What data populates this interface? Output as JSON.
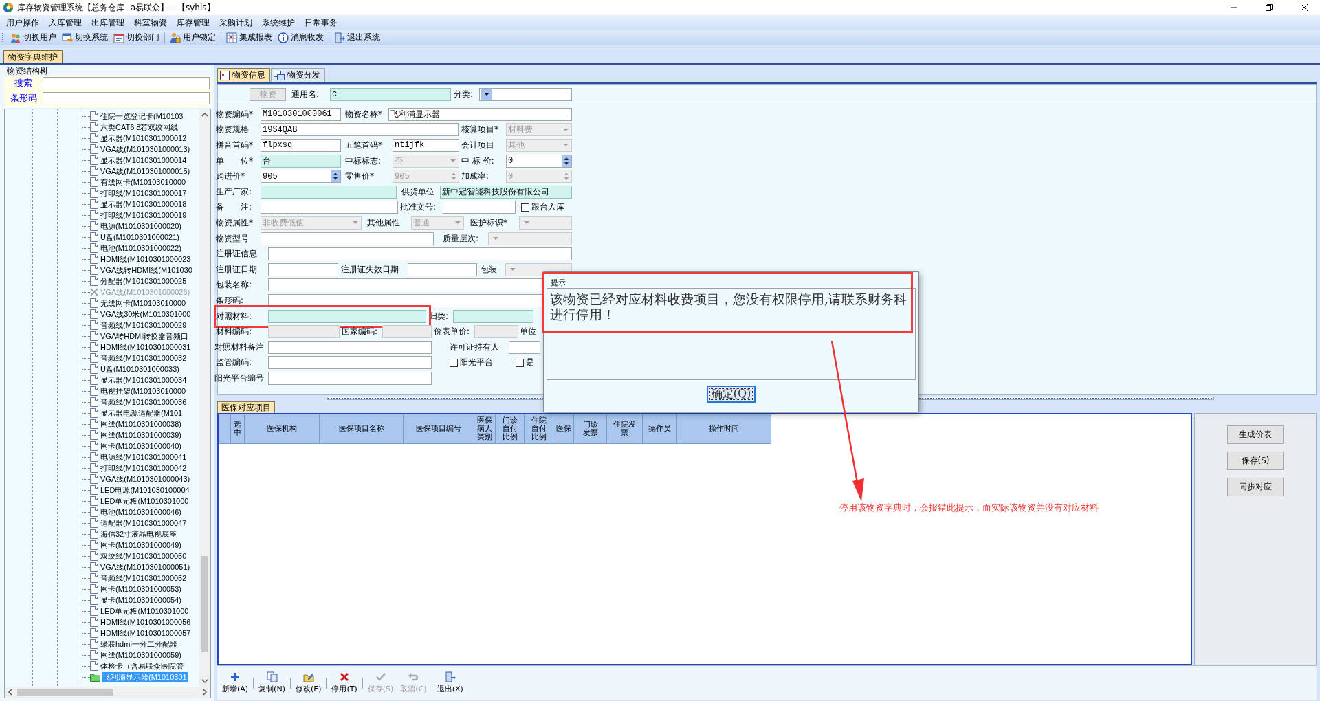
{
  "window": {
    "title": "库存物资管理系统【总务仓库--a易联众】---【syhis】"
  },
  "menu": [
    "用户操作",
    "入库管理",
    "出库管理",
    "科室物资",
    "库存管理",
    "采购计划",
    "系统维护",
    "日常事务"
  ],
  "toolbar_groups": [
    [
      {
        "label": "切换用户"
      },
      {
        "label": "切换系统"
      },
      {
        "label": "切换部门"
      }
    ],
    [
      {
        "label": "用户锁定"
      }
    ],
    [
      {
        "label": "集成报表"
      },
      {
        "label": "消息收发"
      }
    ],
    [
      {
        "label": "退出系统"
      }
    ]
  ],
  "document_tabs": [
    {
      "label": "物资字典维护",
      "selected": true
    }
  ],
  "tree_panel": {
    "title": "物资结构树",
    "search_label": "搜索",
    "barcode_label": "条形码",
    "items": [
      {
        "label": "住院一览登记卡(M10103",
        "disabled": false,
        "selected": false
      },
      {
        "label": "六类CAT6 8芯双绞网线",
        "disabled": false,
        "selected": false
      },
      {
        "label": "显示器(M1010301000012",
        "disabled": false,
        "selected": false
      },
      {
        "label": "VGA线(M1010301000013)",
        "disabled": false,
        "selected": false
      },
      {
        "label": "显示器(M1010301000014",
        "disabled": false,
        "selected": false
      },
      {
        "label": "VGA线(M1010301000015)",
        "disabled": false,
        "selected": false
      },
      {
        "label": "有线网卡(M10103010000",
        "disabled": false,
        "selected": false
      },
      {
        "label": "打印线(M1010301000017",
        "disabled": false,
        "selected": false
      },
      {
        "label": "显示器(M1010301000018",
        "disabled": false,
        "selected": false
      },
      {
        "label": "打印线(M1010301000019",
        "disabled": false,
        "selected": false
      },
      {
        "label": "电源(M1010301000020)",
        "disabled": false,
        "selected": false
      },
      {
        "label": "U盘(M1010301000021)",
        "disabled": false,
        "selected": false
      },
      {
        "label": "电池(M1010301000022)",
        "disabled": false,
        "selected": false
      },
      {
        "label": "HDMI线(M1010301000023",
        "disabled": false,
        "selected": false
      },
      {
        "label": "VGA线转HDMI线(M101030",
        "disabled": false,
        "selected": false
      },
      {
        "label": "分配器(M1010301000025",
        "disabled": false,
        "selected": false
      },
      {
        "label": "VGA线(M1010301000026)",
        "disabled": true,
        "selected": false
      },
      {
        "label": "无线网卡(M10103010000",
        "disabled": false,
        "selected": false
      },
      {
        "label": "VGA线30米(M1010301000",
        "disabled": false,
        "selected": false
      },
      {
        "label": "音频线(M1010301000029",
        "disabled": false,
        "selected": false
      },
      {
        "label": "VGA转HDMI转换器音频口",
        "disabled": false,
        "selected": false
      },
      {
        "label": "HDMI线(M1010301000031",
        "disabled": false,
        "selected": false
      },
      {
        "label": "音频线(M1010301000032",
        "disabled": false,
        "selected": false
      },
      {
        "label": "U盘(M1010301000033)",
        "disabled": false,
        "selected": false
      },
      {
        "label": "显示器(M1010301000034",
        "disabled": false,
        "selected": false
      },
      {
        "label": "电视挂架(M10103010000",
        "disabled": false,
        "selected": false
      },
      {
        "label": "音频线(M1010301000036",
        "disabled": false,
        "selected": false
      },
      {
        "label": "显示器电源适配器(M101",
        "disabled": false,
        "selected": false
      },
      {
        "label": "网线(M1010301000038)",
        "disabled": false,
        "selected": false
      },
      {
        "label": "网线(M1010301000039)",
        "disabled": false,
        "selected": false
      },
      {
        "label": "网卡(M1010301000040)",
        "disabled": false,
        "selected": false
      },
      {
        "label": "电源线(M1010301000041",
        "disabled": false,
        "selected": false
      },
      {
        "label": "打印线(M1010301000042",
        "disabled": false,
        "selected": false
      },
      {
        "label": "VGA线(M1010301000043)",
        "disabled": false,
        "selected": false
      },
      {
        "label": "LED电源(M101030100004",
        "disabled": false,
        "selected": false
      },
      {
        "label": "LED单元板(M1010301000",
        "disabled": false,
        "selected": false
      },
      {
        "label": "电池(M1010301000046)",
        "disabled": false,
        "selected": false
      },
      {
        "label": "适配器(M1010301000047",
        "disabled": false,
        "selected": false
      },
      {
        "label": "海信32寸液晶电视底座",
        "disabled": false,
        "selected": false
      },
      {
        "label": "网卡(M1010301000049)",
        "disabled": false,
        "selected": false
      },
      {
        "label": "双绞线(M1010301000050",
        "disabled": false,
        "selected": false
      },
      {
        "label": "VGA线(M1010301000051)",
        "disabled": false,
        "selected": false
      },
      {
        "label": "音频线(M1010301000052",
        "disabled": false,
        "selected": false
      },
      {
        "label": "网卡(M1010301000053)",
        "disabled": false,
        "selected": false
      },
      {
        "label": "显卡(M1010301000054)",
        "disabled": false,
        "selected": false
      },
      {
        "label": "LED单元板(M1010301000",
        "disabled": false,
        "selected": false
      },
      {
        "label": "HDMI线(M1010301000056",
        "disabled": false,
        "selected": false
      },
      {
        "label": "HDMI线(M1010301000057",
        "disabled": false,
        "selected": false
      },
      {
        "label": "绿联hdmi一分二分配器",
        "disabled": false,
        "selected": false
      },
      {
        "label": "网线(M1010301000059)",
        "disabled": false,
        "selected": false
      },
      {
        "label": "体检卡（含易联众医院管",
        "disabled": false,
        "selected": false
      },
      {
        "label": "飞利浦显示器(M1010301",
        "disabled": false,
        "selected": true
      }
    ]
  },
  "detail_tabs": [
    {
      "label": "物资信息",
      "selected": true
    },
    {
      "label": "物资分发",
      "selected": false
    }
  ],
  "form": {
    "header": [
      {
        "kind": "button",
        "label": "物资",
        "disabled": true
      },
      {
        "kind": "label",
        "text": "通用名:"
      },
      {
        "kind": "input",
        "value": "c",
        "tinted": true,
        "disabled": false
      },
      {
        "kind": "label",
        "text": "分类:"
      },
      {
        "kind": "select",
        "tinted": false,
        "disabled": false
      }
    ],
    "rows": [
      {
        "highlighted": false,
        "items": [
          {
            "kind": "label",
            "text": "物资编码*"
          },
          {
            "kind": "input",
            "value": "M1010301000061",
            "tinted": false,
            "disabled": false
          },
          {
            "kind": "label",
            "text": "物资名称*"
          },
          {
            "kind": "input",
            "value": "飞利浦显示器",
            "tinted": false,
            "disabled": false
          }
        ]
      },
      {
        "highlighted": false,
        "items": [
          {
            "kind": "label",
            "text": "物资规格"
          },
          {
            "kind": "input",
            "value": "19S4QAB",
            "tinted": false,
            "disabled": false
          },
          {
            "kind": "label",
            "text": "核算项目*"
          },
          {
            "kind": "select",
            "value": "材料费",
            "tinted": false,
            "disabled": true
          }
        ]
      },
      {
        "highlighted": false,
        "items": [
          {
            "kind": "label",
            "text": "拼音首码*"
          },
          {
            "kind": "input",
            "value": "flpxsq",
            "tinted": false,
            "disabled": false
          },
          {
            "kind": "label",
            "text": "五笔首码*"
          },
          {
            "kind": "input",
            "value": "ntijfk",
            "tinted": false,
            "disabled": false
          },
          {
            "kind": "label",
            "text": "会计项目"
          },
          {
            "kind": "select",
            "value": "其他",
            "tinted": false,
            "disabled": true
          }
        ]
      },
      {
        "highlighted": false,
        "items": [
          {
            "kind": "label",
            "text": "单　　位*"
          },
          {
            "kind": "input",
            "value": "台",
            "tinted": true,
            "disabled": false
          },
          {
            "kind": "label",
            "text": "中标标志:"
          },
          {
            "kind": "select",
            "value": "否",
            "tinted": false,
            "disabled": true
          },
          {
            "kind": "label",
            "text": "中 标 价:"
          },
          {
            "kind": "spin",
            "value": "0",
            "tinted": false,
            "disabled": false
          }
        ]
      },
      {
        "highlighted": false,
        "items": [
          {
            "kind": "label",
            "text": "购进价*"
          },
          {
            "kind": "spin",
            "value": "905",
            "tinted": false,
            "disabled": false
          },
          {
            "kind": "label",
            "text": "零售价*"
          },
          {
            "kind": "spin",
            "value": "905",
            "tinted": false,
            "disabled": true
          },
          {
            "kind": "label",
            "text": "加成率:"
          },
          {
            "kind": "spin",
            "value": "0",
            "tinted": false,
            "disabled": true
          }
        ]
      },
      {
        "highlighted": false,
        "items": [
          {
            "kind": "label",
            "text": "生产厂家:"
          },
          {
            "kind": "input",
            "tinted": true,
            "disabled": false
          },
          {
            "kind": "label",
            "text": "供货单位"
          },
          {
            "kind": "input",
            "value": "新中冠智能科技股份有限公司",
            "tinted": true,
            "disabled": false
          }
        ]
      },
      {
        "highlighted": false,
        "items": [
          {
            "kind": "label",
            "text": "备　　注:"
          },
          {
            "kind": "input",
            "tinted": false,
            "disabled": false
          },
          {
            "kind": "label",
            "text": "批准文号:"
          },
          {
            "kind": "input",
            "tinted": false,
            "disabled": false
          },
          {
            "kind": "checkbox",
            "label": "跟台入库",
            "checked": false
          }
        ]
      },
      {
        "highlighted": false,
        "items": [
          {
            "kind": "label",
            "text": "物资属性*"
          },
          {
            "kind": "select",
            "value": "非收费低值",
            "tinted": false,
            "disabled": true
          },
          {
            "kind": "label",
            "text": "其他属性"
          },
          {
            "kind": "select",
            "value": "普通",
            "tinted": false,
            "disabled": true
          },
          {
            "kind": "label",
            "text": "医护标识*"
          },
          {
            "kind": "select",
            "tinted": false,
            "disabled": true
          }
        ]
      },
      {
        "highlighted": false,
        "items": [
          {
            "kind": "label",
            "text": "物资型号"
          },
          {
            "kind": "input",
            "tinted": false,
            "disabled": false
          },
          {
            "kind": "label",
            "text": "质量层次:"
          },
          {
            "kind": "select",
            "tinted": false,
            "disabled": true
          }
        ]
      },
      {
        "highlighted": false,
        "items": [
          {
            "kind": "label",
            "text": "注册证信息"
          },
          {
            "kind": "input",
            "tinted": false,
            "disabled": false
          }
        ]
      },
      {
        "highlighted": false,
        "items": [
          {
            "kind": "label",
            "text": "注册证日期"
          },
          {
            "kind": "input",
            "tinted": false,
            "disabled": false
          },
          {
            "kind": "label",
            "text": "注册证失效日期"
          },
          {
            "kind": "input",
            "tinted": false,
            "disabled": false
          },
          {
            "kind": "label",
            "text": "包装"
          },
          {
            "kind": "select",
            "tinted": false,
            "disabled": true
          }
        ]
      },
      {
        "highlighted": false,
        "items": [
          {
            "kind": "label",
            "text": "包装名称:"
          },
          {
            "kind": "input",
            "tinted": false,
            "disabled": false
          }
        ]
      },
      {
        "highlighted": false,
        "items": [
          {
            "kind": "label",
            "text": "条形码:"
          },
          {
            "kind": "input",
            "tinted": false,
            "disabled": false
          }
        ]
      },
      {
        "highlighted": true,
        "items": [
          {
            "kind": "label",
            "text": "对照材料:"
          },
          {
            "kind": "input",
            "tinted": true,
            "disabled": false
          },
          {
            "kind": "label",
            "text": "归类:"
          },
          {
            "kind": "input",
            "tinted": true,
            "disabled": false
          }
        ]
      },
      {
        "highlighted": false,
        "items": [
          {
            "kind": "label",
            "text": "材料编码:"
          },
          {
            "kind": "input",
            "tinted": false,
            "disabled": true
          },
          {
            "kind": "label",
            "text": "国家编码:"
          },
          {
            "kind": "input",
            "tinted": false,
            "disabled": true
          },
          {
            "kind": "label",
            "text": "价表单价:"
          },
          {
            "kind": "input",
            "tinted": false,
            "disabled": true
          },
          {
            "kind": "label",
            "text": "单位"
          }
        ]
      },
      {
        "highlighted": false,
        "items": [
          {
            "kind": "label",
            "text": "对照材料备注"
          },
          {
            "kind": "input",
            "tinted": false,
            "disabled": false
          },
          {
            "kind": "label",
            "text": "许可证持有人"
          },
          {
            "kind": "input",
            "tinted": false,
            "disabled": false
          }
        ]
      },
      {
        "highlighted": false,
        "items": [
          {
            "kind": "label",
            "text": "监管编码:"
          },
          {
            "kind": "input",
            "tinted": false,
            "disabled": false
          },
          {
            "kind": "checkbox",
            "label": "阳光平台",
            "checked": false
          },
          {
            "kind": "checkbox",
            "label": "是",
            "checked": false
          }
        ]
      },
      {
        "highlighted": false,
        "items": [
          {
            "kind": "label",
            "text": "阳光平台编号"
          },
          {
            "kind": "input",
            "tinted": false,
            "disabled": false
          }
        ]
      }
    ]
  },
  "insurance_tabs": [
    {
      "label": "医保对应项目",
      "selected": true
    }
  ],
  "insurance_table": {
    "columns": [
      "选中",
      "医保机构",
      "医保项目名称",
      "医保项目编号",
      "医保病人类别",
      "门诊自付比例",
      "住院自付比例",
      "医保",
      "门诊发票",
      "住院发票",
      "操作员",
      "操作时间"
    ]
  },
  "side_buttons": [
    "生成价表",
    "保存(S)",
    "同步对应"
  ],
  "bottom_toolbar_groups": [
    [
      {
        "label": "新增(A)",
        "disabled": false
      }
    ],
    [
      {
        "label": "复制(N)",
        "disabled": false
      }
    ],
    [
      {
        "label": "修改(E)",
        "disabled": false
      }
    ],
    [
      {
        "label": "停用(T)",
        "disabled": false
      }
    ],
    [
      {
        "label": "保存(S)",
        "disabled": true
      },
      {
        "label": "取消(C)",
        "disabled": true
      }
    ],
    [
      {
        "label": "退出(X)",
        "disabled": false
      }
    ]
  ],
  "dialog": {
    "title": "提示",
    "message": "该物资已经对应材料收费项目，您没有权限停用,请联系财务科进行停用！",
    "button": "确定(Q)",
    "highlighted": true
  },
  "annotation": {
    "text": "停用该物资字典时，会报错此提示，而实际该物资并没有对应材料"
  }
}
